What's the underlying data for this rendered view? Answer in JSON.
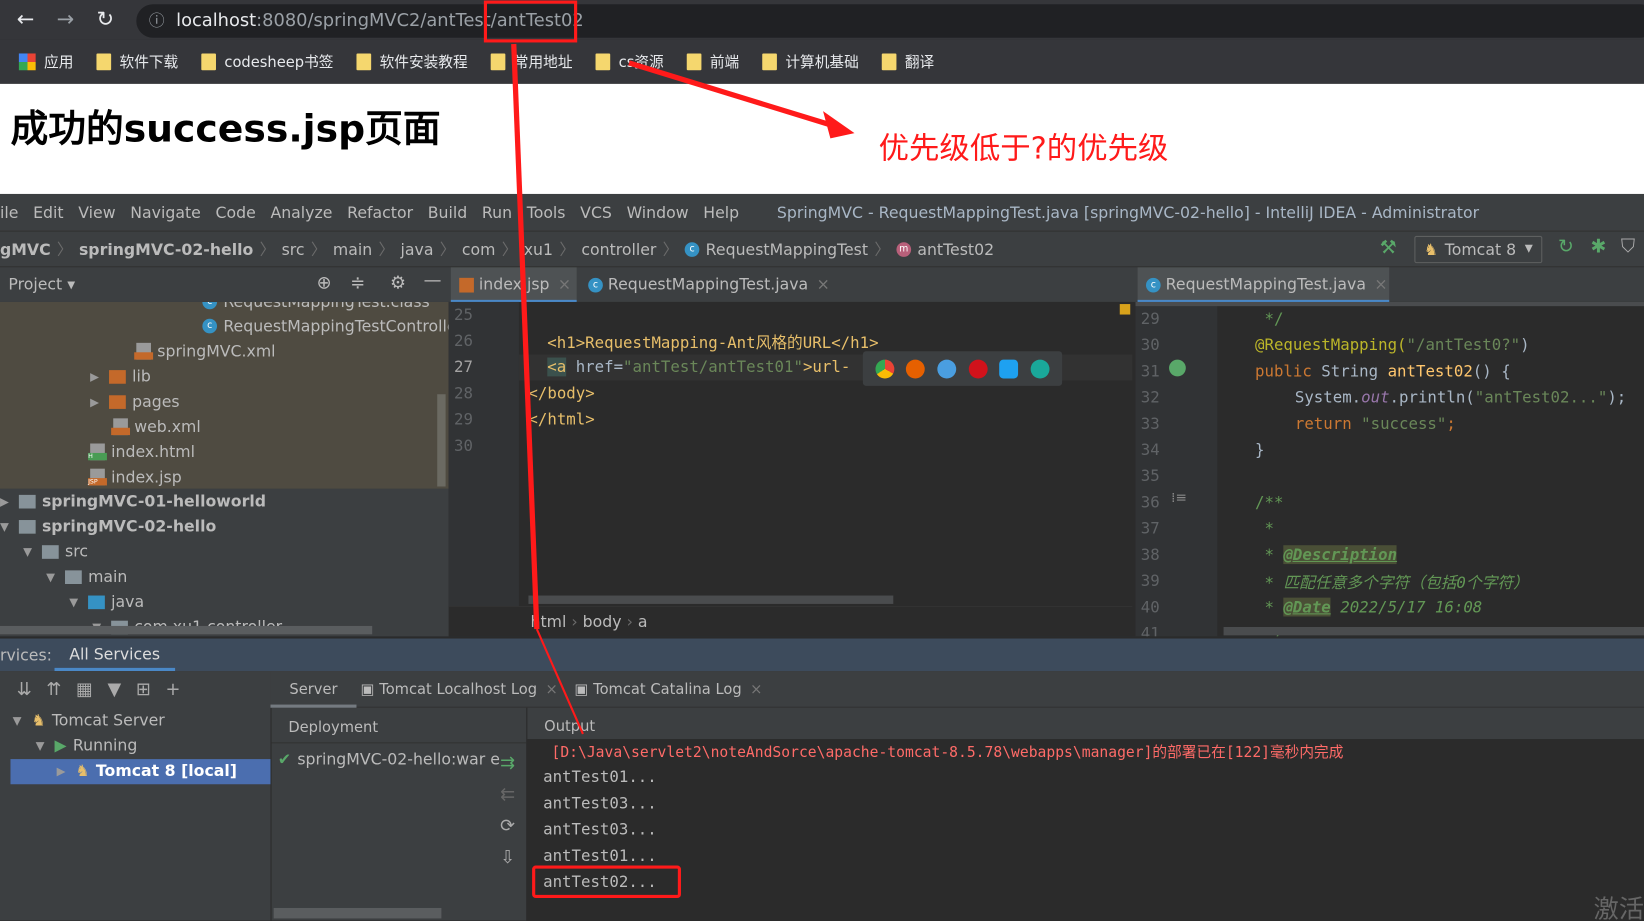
{
  "browser": {
    "url_host": "localhost",
    "url_path": ":8080/springMVC2/antTest/antTest02",
    "bookmarks": [
      "应用",
      "软件下载",
      "codesheep书签",
      "软件安装教程",
      "常用地址",
      "cs资源",
      "前端",
      "计算机基础",
      "翻译"
    ]
  },
  "page": {
    "heading": "成功的success.jsp页面",
    "annotation": "优先级低于?的优先级",
    "annotation_color": "#ff1a1a"
  },
  "ide": {
    "menu": [
      "ile",
      "Edit",
      "View",
      "Navigate",
      "Code",
      "Analyze",
      "Refactor",
      "Build",
      "Run",
      "Tools",
      "VCS",
      "Window",
      "Help"
    ],
    "title": "SpringMVC - RequestMappingTest.java [springMVC-02-hello] - IntelliJ IDEA - Administrator",
    "breadcrumb": [
      "gMVC",
      "springMVC-02-hello",
      "src",
      "main",
      "java",
      "com",
      "xu1",
      "controller",
      "RequestMappingTest",
      "antTest02"
    ],
    "run_config": "Tomcat 8",
    "project_label": "Project",
    "editor_tabs": [
      "index.jsp",
      "RequestMappingTest.java"
    ],
    "right_tab": "RequestMappingTest.java",
    "tree": [
      {
        "label": "RequestMappingTest.class",
        "type": "class"
      },
      {
        "label": "RequestMappingTestControlle",
        "type": "class"
      },
      {
        "label": "springMVC.xml",
        "type": "xml"
      },
      {
        "label": "lib",
        "type": "folder"
      },
      {
        "label": "pages",
        "type": "folder"
      },
      {
        "label": "web.xml",
        "type": "xml"
      },
      {
        "label": "index.html",
        "type": "html"
      },
      {
        "label": "index.jsp",
        "type": "jsp"
      },
      {
        "label": "springMVC-01-helloworld",
        "type": "module"
      },
      {
        "label": "springMVC-02-hello",
        "type": "module"
      },
      {
        "label": "src",
        "type": "folder"
      },
      {
        "label": "main",
        "type": "folder"
      },
      {
        "label": "java",
        "type": "folder"
      },
      {
        "label": "com.xu1.controller",
        "type": "package"
      }
    ],
    "left_code": {
      "lines": [
        "25",
        "26",
        "27",
        "28",
        "29",
        "30"
      ],
      "l26": "<h1>RequestMapping-Ant风格的URL</h1>",
      "l27a": "<a",
      "l27b": " href=",
      "l27c": "\"antTest/antTest01\"",
      "l27d": ">url-",
      "l28": "</body>",
      "l29": "</html>"
    },
    "left_crumb": [
      "html",
      "body",
      "a"
    ],
    "right_code": {
      "lines": [
        "29",
        "30",
        "31",
        "32",
        "33",
        "34",
        "35",
        "36",
        "37",
        "38",
        "39",
        "40",
        "41"
      ],
      "l29": " */",
      "l30a": "@RequestMapping(",
      "l30b": "\"/antTest0?\"",
      "l30c": ")",
      "l31a": "public ",
      "l31b": "String ",
      "l31c": "antTest02",
      "l31d": "() {",
      "l32a": "System.",
      "l32b": "out",
      "l32c": ".println(",
      "l32d": "\"antTest02...\"",
      "l32e": ");",
      "l33a": "return ",
      "l33b": "\"success\"",
      "l33c": ";",
      "l34": "}",
      "l36": "/**",
      "l37": " *",
      "l38a": " * ",
      "l38b": "@Description",
      "l39": " * 匹配任意多个字符（包括0个字符）",
      "l40a": " * ",
      "l40b": "@Date",
      "l40c": " 2022/5/17 16:08",
      "l41": " */"
    }
  },
  "services": {
    "label": "rvices:",
    "tab": "All Services",
    "tree": [
      "Tomcat Server",
      "Running",
      "Tomcat 8 [local]"
    ],
    "sub_tabs": [
      "Server",
      "Tomcat Localhost Log",
      "Tomcat Catalina Log"
    ],
    "deployment_header": "Deployment",
    "deployment_item": "springMVC-02-hello:war e",
    "output_header": "Output",
    "output": [
      "[D:\\Java\\servlet2\\noteAndSorce\\apache-tomcat-8.5.78\\webapps\\manager]的部署已在[122]毫秒内完成",
      "antTest01...",
      "antTest03...",
      "antTest03...",
      "antTest01...",
      "antTest02..."
    ],
    "watermark": "激活"
  }
}
